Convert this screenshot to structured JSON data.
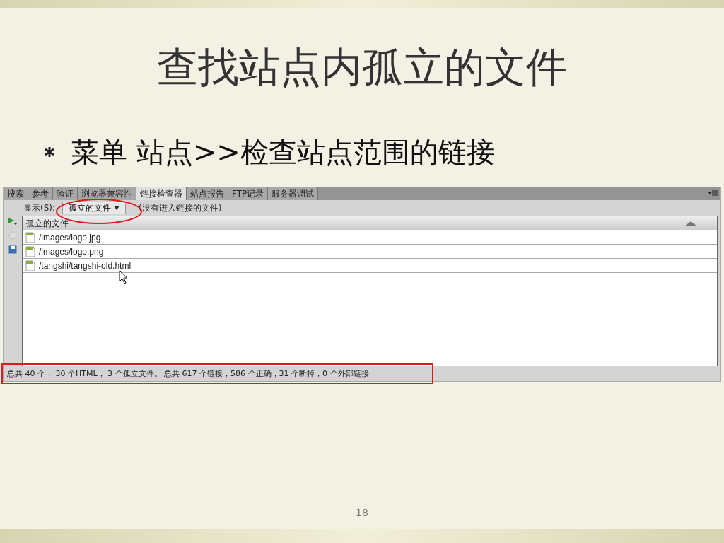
{
  "slide": {
    "title": "查找站点内孤立的文件",
    "bullets": [
      "菜单 站点>>检查站点范围的链接"
    ],
    "page_number": "18"
  },
  "panel": {
    "tabs": [
      {
        "label": "搜索",
        "selected": false
      },
      {
        "label": "参考",
        "selected": false
      },
      {
        "label": "验证",
        "selected": false
      },
      {
        "label": "浏览器兼容性",
        "selected": false
      },
      {
        "label": "链接检查器",
        "selected": true
      },
      {
        "label": "站点报告",
        "selected": false
      },
      {
        "label": "FTP记录",
        "selected": false
      },
      {
        "label": "服务器调试",
        "selected": false
      }
    ],
    "show_label": "显示(S):",
    "show_select": "孤立的文件",
    "show_hint": "(没有进入链接的文件)",
    "column": "孤立的文件",
    "files": [
      "/images/logo.jpg",
      "/images/logo.png",
      "/tangshi/tangshi-old.html"
    ],
    "status": "总共 40 个， 30 个HTML， 3 个孤立文件。 总共 617 个链接，586 个正确，31 个断掉，0 个外部链接"
  }
}
